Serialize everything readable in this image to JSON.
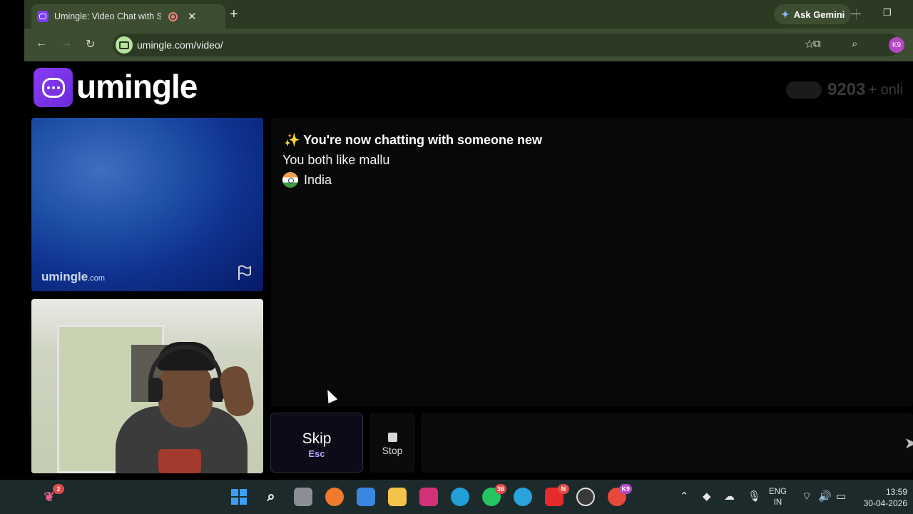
{
  "browser": {
    "tab_title": "Umingle: Video Chat with Strangers",
    "new_tab_symbol": "+",
    "ask_gemini": "Ask Gemini",
    "url": "umingle.com/video/",
    "profile_initials": "K9",
    "icons": [
      "back-icon",
      "forward-icon",
      "reload-icon",
      "bookmark-star-icon",
      "extensions-icon",
      "tab-search-icon",
      "minimize-icon",
      "restore-icon"
    ]
  },
  "site": {
    "logo_text": "umingle",
    "online_count": "9203",
    "online_suffix": "+ onli",
    "watermark_main": "umingle",
    "watermark_domain": ".com"
  },
  "chat": {
    "line1": "✨ You're now chatting with someone new",
    "line2": "You both like mallu",
    "country": "India"
  },
  "controls": {
    "skip_label": "Skip",
    "skip_key": "Esc",
    "stop_label": "Stop",
    "message_placeholder": ""
  },
  "taskbar": {
    "widgets_badge": "2",
    "whatsapp_badge": "36",
    "youtube_badge": "N",
    "chrome_badge": "K9",
    "lang_line1": "ENG",
    "lang_line2": "IN",
    "time": "13:59",
    "date": "30-04-2026",
    "colors": {
      "start": "#2f8ff0",
      "firefox": "#f0792c",
      "store": "#3a86e0",
      "explorer": "#f3c34a",
      "instagram": "#d5317b",
      "edge": "#21a0d8",
      "whatsapp": "#25c463",
      "telegram": "#2aa2dc",
      "youtube": "#e52b2b",
      "obs": "#3a3a3a",
      "chrome": "#e8483a"
    }
  }
}
